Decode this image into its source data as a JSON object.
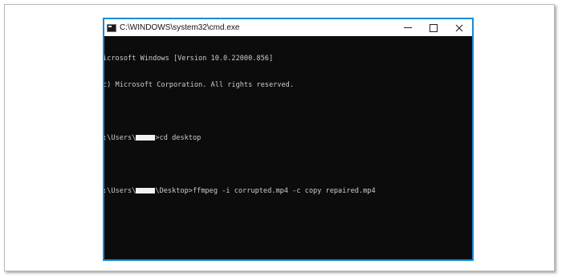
{
  "window": {
    "title": "C:\\WINDOWS\\system32\\cmd.exe",
    "controls": [
      "minimize",
      "maximize",
      "close"
    ]
  },
  "console": {
    "line1": "icrosoft Windows [Version 10.0.22000.856]",
    "line2": "c) Microsoft Corporation. All rights reserved.",
    "prompt1_prefix": ":\\Users\\",
    "prompt1_command": ">cd desktop",
    "prompt2_prefix": ":\\Users\\",
    "prompt2_command": "\\Desktop>ffmpeg -i corrupted.mp4 -c copy repaired.mp4"
  },
  "colors": {
    "window_border": "#1a8ad4",
    "console_background": "#0c0c0c",
    "console_text": "#cccccc"
  }
}
